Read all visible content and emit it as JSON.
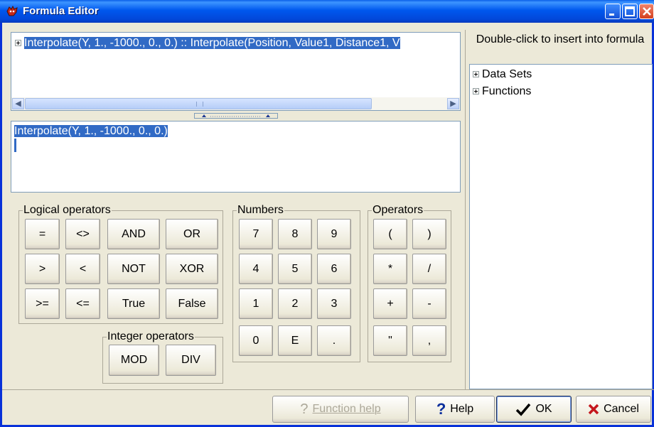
{
  "window": {
    "title": "Formula Editor"
  },
  "formula_tree": {
    "item": "Interpolate(Y, 1., -1000., 0., 0.) :: Interpolate(Position, Value1, Distance1, V"
  },
  "editor": {
    "text": "Interpolate(Y, 1., -1000., 0., 0.)"
  },
  "groups": {
    "logical": {
      "label": "Logical operators",
      "buttons": [
        "=",
        "<>",
        "AND",
        "OR",
        ">",
        "<",
        "NOT",
        "XOR",
        ">=",
        "<=",
        "True",
        "False"
      ]
    },
    "integer": {
      "label": "Integer operators",
      "buttons": [
        "MOD",
        "DIV"
      ]
    },
    "numbers": {
      "label": "Numbers",
      "buttons": [
        "7",
        "8",
        "9",
        "4",
        "5",
        "6",
        "1",
        "2",
        "3",
        "0",
        "E",
        "."
      ]
    },
    "operators": {
      "label": "Operators",
      "buttons": [
        "(",
        ")",
        "*",
        "/",
        "+",
        "-",
        "\"",
        ","
      ]
    }
  },
  "insert_panel": {
    "header": "Double-click to insert into formula",
    "items": [
      "Data Sets",
      "Functions"
    ]
  },
  "footer": {
    "function_help": "Function help",
    "help": "Help",
    "ok": "OK",
    "cancel": "Cancel"
  }
}
